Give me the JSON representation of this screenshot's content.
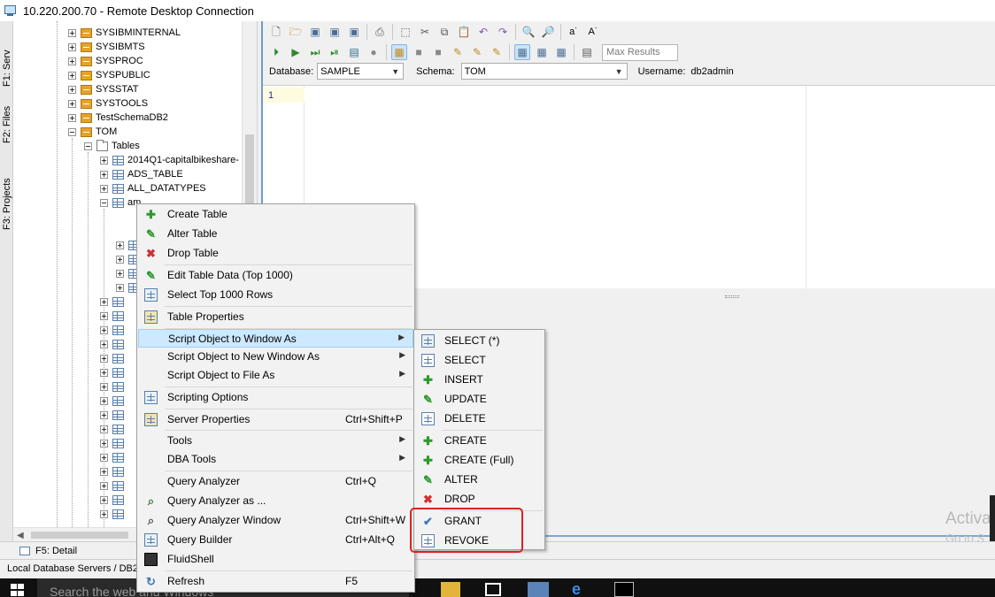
{
  "window": {
    "title": "10.220.200.70 - Remote Desktop Connection"
  },
  "side_tabs": {
    "servers": "F1: Serv",
    "files": "F2: Files",
    "projects": "F3: Projects"
  },
  "tree": {
    "schemas": [
      "SYSIBMINTERNAL",
      "SYSIBMTS",
      "SYSPROC",
      "SYSPUBLIC",
      "SYSSTAT",
      "SYSTOOLS",
      "TestSchemaDB2",
      "TOM"
    ],
    "tables_folder": "Tables",
    "tables": [
      "2014Q1-capitalbikeshare-",
      "ADS_TABLE",
      "ALL_DATATYPES",
      "am"
    ]
  },
  "toolbar": {
    "max_results_placeholder": "Max Results",
    "database_label": "Database:",
    "database_value": "SAMPLE",
    "schema_label": "Schema:",
    "schema_value": "TOM",
    "username_label": "Username:",
    "username_value": "db2admin"
  },
  "editor": {
    "line_number": "1"
  },
  "bottom": {
    "tab_label": "F5: Detail",
    "status_text": "Local Database Servers / DB2"
  },
  "taskbar": {
    "search_text": "Search the web and Windows"
  },
  "watermark": {
    "line1": "Activa",
    "line2": "Go to S"
  },
  "context_menu": {
    "create_table": "Create Table",
    "alter_table": "Alter Table",
    "drop_table": "Drop Table",
    "edit_table_data": "Edit Table Data (Top 1000)",
    "select_top": "Select Top 1000 Rows",
    "table_properties": "Table Properties",
    "script_to_window": "Script Object to Window As",
    "script_to_new_window": "Script Object to New Window As",
    "script_to_file": "Script Object to File As",
    "scripting_options": "Scripting Options",
    "server_properties": "Server Properties",
    "server_properties_sc": "Ctrl+Shift+P",
    "tools": "Tools",
    "dba_tools": "DBA Tools",
    "query_analyzer": "Query Analyzer",
    "query_analyzer_sc": "Ctrl+Q",
    "query_analyzer_as": "Query Analyzer as ...",
    "query_analyzer_window": "Query Analyzer Window",
    "query_analyzer_window_sc": "Ctrl+Shift+W",
    "query_builder": "Query Builder",
    "query_builder_sc": "Ctrl+Alt+Q",
    "fluidshell": "FluidShell",
    "refresh": "Refresh",
    "refresh_sc": "F5"
  },
  "submenu": {
    "select_star": "SELECT (*)",
    "select": "SELECT",
    "insert": "INSERT",
    "update": "UPDATE",
    "delete": "DELETE",
    "create": "CREATE",
    "create_full": "CREATE (Full)",
    "alter": "ALTER",
    "drop": "DROP",
    "grant": "GRANT",
    "revoke": "REVOKE"
  },
  "colors": {
    "highlight": "#cde8ff",
    "annotation_red": "#e02020",
    "accent_blue": "#6d9bd1"
  }
}
